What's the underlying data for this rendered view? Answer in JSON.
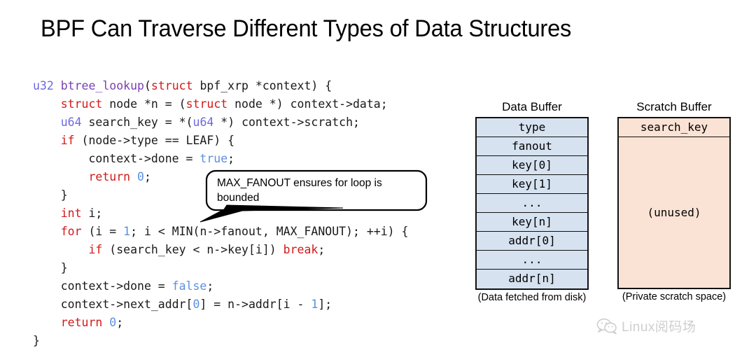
{
  "slide": {
    "title": "BPF Can Traverse Different Types of Data Structures",
    "background": "#ffffff"
  },
  "code": {
    "language": "c",
    "lines": [
      [
        {
          "t": "u32 ",
          "c": "type"
        },
        {
          "t": "btree_lookup",
          "c": "fn"
        },
        {
          "t": "(",
          "c": "plain"
        },
        {
          "t": "struct",
          "c": "kw"
        },
        {
          "t": " bpf_xrp *context) {",
          "c": "plain"
        }
      ],
      [
        {
          "t": "    ",
          "c": "plain"
        },
        {
          "t": "struct",
          "c": "kw"
        },
        {
          "t": " node *n = (",
          "c": "plain"
        },
        {
          "t": "struct",
          "c": "kw"
        },
        {
          "t": " node *) context->data;",
          "c": "plain"
        }
      ],
      [
        {
          "t": "    ",
          "c": "plain"
        },
        {
          "t": "u64",
          "c": "type"
        },
        {
          "t": " search_key = *(",
          "c": "plain"
        },
        {
          "t": "u64",
          "c": "type"
        },
        {
          "t": " *) context->scratch;",
          "c": "plain"
        }
      ],
      [
        {
          "t": "    ",
          "c": "plain"
        },
        {
          "t": "if",
          "c": "kw"
        },
        {
          "t": " (node->type == LEAF) {",
          "c": "plain"
        }
      ],
      [
        {
          "t": "        context->done = ",
          "c": "plain"
        },
        {
          "t": "true",
          "c": "lit"
        },
        {
          "t": ";",
          "c": "plain"
        }
      ],
      [
        {
          "t": "        ",
          "c": "plain"
        },
        {
          "t": "return",
          "c": "kw"
        },
        {
          "t": " ",
          "c": "plain"
        },
        {
          "t": "0",
          "c": "lit"
        },
        {
          "t": ";",
          "c": "plain"
        }
      ],
      [
        {
          "t": "    }",
          "c": "plain"
        }
      ],
      [
        {
          "t": "    ",
          "c": "plain"
        },
        {
          "t": "int",
          "c": "kw"
        },
        {
          "t": " i;",
          "c": "plain"
        }
      ],
      [
        {
          "t": "    ",
          "c": "plain"
        },
        {
          "t": "for",
          "c": "kw"
        },
        {
          "t": " (i = ",
          "c": "plain"
        },
        {
          "t": "1",
          "c": "lit"
        },
        {
          "t": "; i < MIN(n->fanout, MAX_FANOUT); ++i) {",
          "c": "plain"
        }
      ],
      [
        {
          "t": "        ",
          "c": "plain"
        },
        {
          "t": "if",
          "c": "kw"
        },
        {
          "t": " (search_key < n->key[i]) ",
          "c": "plain"
        },
        {
          "t": "break",
          "c": "kw"
        },
        {
          "t": ";",
          "c": "plain"
        }
      ],
      [
        {
          "t": "    }",
          "c": "plain"
        }
      ],
      [
        {
          "t": "    context->done = ",
          "c": "plain"
        },
        {
          "t": "false",
          "c": "lit"
        },
        {
          "t": ";",
          "c": "plain"
        }
      ],
      [
        {
          "t": "    context->next_addr[",
          "c": "plain"
        },
        {
          "t": "0",
          "c": "lit"
        },
        {
          "t": "] = n->addr[i - ",
          "c": "plain"
        },
        {
          "t": "1",
          "c": "lit"
        },
        {
          "t": "];",
          "c": "plain"
        }
      ],
      [
        {
          "t": "    ",
          "c": "plain"
        },
        {
          "t": "return",
          "c": "kw"
        },
        {
          "t": " ",
          "c": "plain"
        },
        {
          "t": "0",
          "c": "lit"
        },
        {
          "t": ";",
          "c": "plain"
        }
      ],
      [
        {
          "t": "}",
          "c": "plain"
        }
      ]
    ],
    "colors": {
      "type": "#6a6ae0",
      "function": "#7a3fb5",
      "keyword": "#d21919",
      "literal": "#5b8fe0",
      "plain": "#1a1a1a"
    }
  },
  "callout": {
    "text": "MAX_FANOUT ensures for loop is bounded",
    "border_color": "#000000",
    "fill_color": "#ffffff"
  },
  "data_buffer": {
    "label": "Data Buffer",
    "caption": "(Data fetched from disk)",
    "fill_color": "#d6e2f0",
    "border_color": "#111111",
    "rows": [
      "type",
      "fanout",
      "key[0]",
      "key[1]",
      "...",
      "key[n]",
      "addr[0]",
      "...",
      "addr[n]"
    ]
  },
  "scratch_buffer": {
    "label": "Scratch Buffer",
    "caption": "(Private scratch space)",
    "fill_color": "#fae3d5",
    "border_color": "#111111",
    "key_row": "search_key",
    "unused_row": "(unused)"
  },
  "watermark": {
    "icon": "wechat-icon",
    "text": "Linux阅码场",
    "color": "#8c8c8c"
  }
}
